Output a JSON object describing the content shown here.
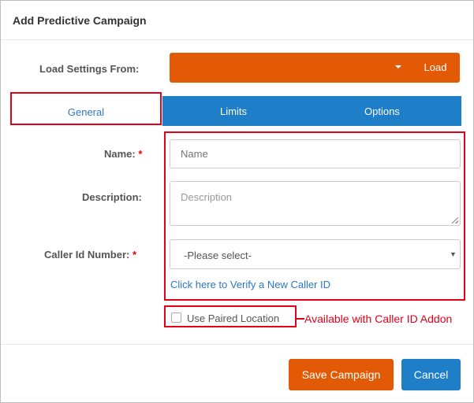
{
  "modal": {
    "title": "Add Predictive Campaign"
  },
  "load_settings": {
    "label": "Load Settings From:",
    "button": "Load"
  },
  "tabs": [
    {
      "label": "General",
      "active": true
    },
    {
      "label": "Limits",
      "active": false
    },
    {
      "label": "Options",
      "active": false
    }
  ],
  "form": {
    "name_label": "Name:",
    "name_placeholder": "Name",
    "description_label": "Description:",
    "description_placeholder": "Description",
    "caller_id_label": "Caller Id Number:",
    "caller_id_selected": "-Please select-",
    "required_mark": "*",
    "verify_link": "Click here to Verify a New Caller ID",
    "paired_location_label": "Use Paired Location",
    "paired_location_checked": false,
    "addon_note": "Available with Caller ID Addon"
  },
  "footer": {
    "save_label": "Save Campaign",
    "cancel_label": "Cancel"
  },
  "colors": {
    "orange": "#e25a05",
    "blue": "#1f7ec8",
    "annotation_red": "#e2001a",
    "link": "#2a78c2"
  }
}
